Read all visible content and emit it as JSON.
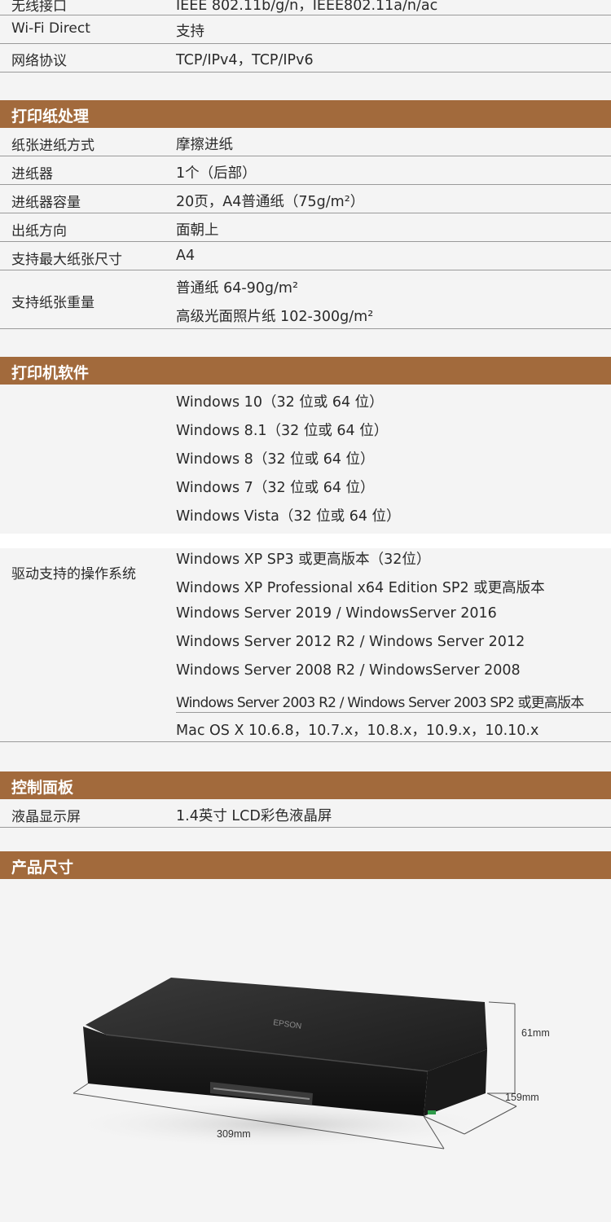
{
  "network": {
    "rows": [
      {
        "label": "无线接口",
        "value": "IEEE 802.11b/g/n，IEEE802.11a/n/ac"
      },
      {
        "label": "Wi-Fi Direct",
        "value": "支持"
      },
      {
        "label": "网络协议",
        "value": "TCP/IPv4，TCP/IPv6"
      }
    ]
  },
  "paper_handling": {
    "title": "打印纸处理",
    "rows": [
      {
        "label": "纸张进纸方式",
        "value": "摩擦进纸"
      },
      {
        "label": "进纸器",
        "value": "1个（后部）"
      },
      {
        "label": "进纸器容量",
        "value": "20页，A4普通纸（75g/m²）"
      },
      {
        "label": "出纸方向",
        "value": "面朝上"
      },
      {
        "label": "支持最大纸张尺寸",
        "value": "A4"
      }
    ],
    "weight": {
      "label": "支持纸张重量",
      "lines": [
        "普通纸 64-90g/m²",
        "高级光面照片纸 102-300g/m²"
      ]
    }
  },
  "software": {
    "title": "打印机软件",
    "label": "驱动支持的操作系统",
    "lines": [
      "Windows 10（32 位或 64 位）",
      "Windows 8.1（32 位或 64 位）",
      "Windows 8（32 位或 64 位）",
      "Windows 7（32 位或 64 位）",
      "Windows Vista（32 位或 64 位）",
      "Windows XP SP3 或更高版本（32位）",
      "Windows XP Professional x64 Edition SP2 或更高版本",
      "Windows Server 2019 / WindowsServer 2016",
      "Windows Server 2012 R2 / Windows Server 2012",
      "Windows Server 2008 R2 / WindowsServer 2008",
      "Windows Server 2003 R2 / Windows Server 2003 SP2 或更高版本",
      "Mac OS X 10.6.8，10.7.x，10.8.x，10.9.x，10.10.x"
    ]
  },
  "control_panel": {
    "title": "控制面板",
    "rows": [
      {
        "label": "液晶显示屏",
        "value": "1.4英寸 LCD彩色液晶屏"
      }
    ]
  },
  "dimensions": {
    "title": "产品尺寸",
    "height": "61mm",
    "depth": "159mm",
    "width": "309mm",
    "brand": "EPSON"
  },
  "colors": {
    "header_bg": "#a26a3c",
    "header_text": "#ffffff",
    "page_bg": "#f4f4f4"
  }
}
